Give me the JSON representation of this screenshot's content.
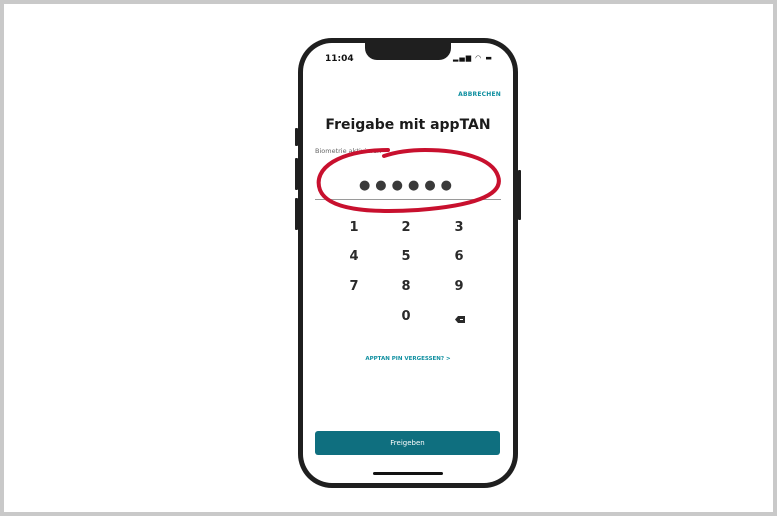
{
  "status_bar": {
    "time": "11:04",
    "icons": "signal-wifi-battery"
  },
  "header": {
    "cancel_label": "ABBRECHEN",
    "title": "Freigabe mit appTAN"
  },
  "biometrics_label": "Biometrie aktivieren",
  "pin": {
    "dots": "●●●●●●"
  },
  "keypad": {
    "keys": [
      "1",
      "2",
      "3",
      "4",
      "5",
      "6",
      "7",
      "8",
      "9",
      "0"
    ],
    "backspace_icon": "backspace-icon"
  },
  "forgot_pin_label": "APPTAN PIN VERGESSEN? >",
  "release_button_label": "Freigeben",
  "colors": {
    "accent": "#0f8fa0",
    "button": "#0f6f7f",
    "annotation": "#c8102e"
  }
}
